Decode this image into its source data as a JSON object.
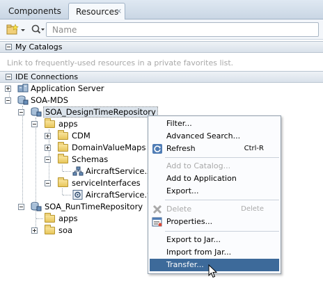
{
  "tabs": {
    "components": "Components",
    "resources": "Resources",
    "close_glyph": "×"
  },
  "toolbar": {
    "search_placeholder": "Name"
  },
  "sections": {
    "my_catalogs": "My Catalogs",
    "catalogs_hint": "Link to frequently-used resources in a private favorites list.",
    "ide_connections": "IDE Connections"
  },
  "tree": {
    "application_server": "Application Server",
    "soa_mds": "SOA-MDS",
    "design_repo": "SOA_DesignTimeRepository",
    "apps": "apps",
    "cdm": "CDM",
    "domain_value_maps": "DomainValueMaps",
    "schemas": "Schemas",
    "aircraft_xsd": "AircraftService.x",
    "service_interfaces": "serviceInterfaces",
    "aircraft_wsdl": "AircraftService.w",
    "runtime_repo": "SOA_RunTimeRepository",
    "rt_apps": "apps",
    "rt_soa": "soa"
  },
  "context_menu": {
    "filter": "Filter...",
    "advanced_search": "Advanced Search...",
    "refresh": "Refresh",
    "refresh_shortcut": "Ctrl-R",
    "add_to_catalog": "Add to Catalog...",
    "add_to_application": "Add to Application",
    "export": "Export...",
    "delete": "Delete",
    "delete_shortcut": "Delete",
    "properties": "Properties...",
    "export_to_jar": "Export to Jar...",
    "import_from_jar": "Import from Jar...",
    "transfer": "Transfer..."
  },
  "colors": {
    "menu_highlight": "#3d6a9a",
    "folder": "#e8c65b"
  }
}
